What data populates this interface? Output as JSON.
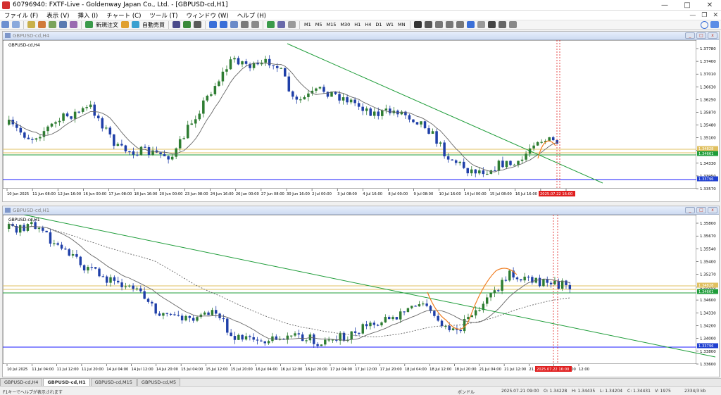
{
  "window": {
    "title": "60796940: FXTF-Live - Goldenway Japan Co., Ltd. - [GBPUSD-cd,H1]"
  },
  "menu": {
    "items": [
      "ファイル (F)",
      "表示 (V)",
      "挿入 (I)",
      "チャート (C)",
      "ツール (T)",
      "ウィンドウ (W)",
      "ヘルプ (H)"
    ]
  },
  "toolbar": {
    "new_order_label": "新規注文",
    "auto_trade_label": "自動売買",
    "timeframes": [
      "M1",
      "M5",
      "M15",
      "M30",
      "H1",
      "H4",
      "D1",
      "W1",
      "MN"
    ]
  },
  "charts": [
    {
      "window_title": "GBPUSD-cd,H4",
      "inner_label": "GBPUSD-cd,H4",
      "price_labels": [
        "1.37780",
        "1.37400",
        "1.37010",
        "1.36630",
        "1.36250",
        "1.35870",
        "1.35480",
        "1.35100",
        "1.34720",
        "1.34330",
        "1.33950",
        "1.33570"
      ],
      "time_labels": [
        "10 Jun 2025",
        "11 Jun 08:00",
        "12 Jun 16:00",
        "16 Jun 00:00",
        "17 Jun 08:00",
        "18 Jun 16:00",
        "20 Jun 00:00",
        "23 Jun 08:00",
        "24 Jun 16:00",
        "26 Jun 00:00",
        "27 Jun 08:00",
        "30 Jun 16:00",
        "2 Jul 00:00",
        "3 Jul 08:00",
        "4 Jul 16:00",
        "8 Jul 00:00",
        "9 Jul 08:00",
        "10 Jul 16:00",
        "14 Jul 00:00",
        "15 Jul 08:00",
        "16 Jul 16:00",
        "18 Jul 00:00",
        "21"
      ],
      "date_marker": "2025.07.22 16:00",
      "hline_labels": [
        "1.34828",
        "1.34661",
        "1.33796"
      ]
    },
    {
      "window_title": "GBPUSD-cd,H1",
      "inner_label": "GBPUSD-cd,H1",
      "price_labels": [
        "1.35800",
        "1.35670",
        "1.35540",
        "1.35400",
        "1.35270",
        "1.35000",
        "1.34600",
        "1.34330",
        "1.34200",
        "1.34000",
        "1.33800",
        "1.33600"
      ],
      "time_labels": [
        "10 Jul 2025",
        "11 Jul 04:00",
        "11 Jul 12:00",
        "11 Jul 20:00",
        "14 Jul 04:00",
        "14 Jul 12:00",
        "14 Jul 20:00",
        "15 Jul 04:00",
        "15 Jul 12:00",
        "15 Jul 20:00",
        "16 Jul 04:00",
        "16 Jul 12:00",
        "16 Jul 20:00",
        "17 Jul 04:00",
        "17 Jul 12:00",
        "17 Jul 20:00",
        "18 Jul 04:00",
        "18 Jul 12:00",
        "18 Jul 20:00",
        "21 Jul 04:00",
        "21 Jul 12:00",
        "21 Jul 20:00",
        "22 Jul 04:00",
        "12:00"
      ],
      "date_marker": "2025.07.22 16:00",
      "hline_labels": [
        "1.34828",
        "1.34661",
        "1.33796"
      ]
    }
  ],
  "tabs": [
    "GBPUSD-cd,H4",
    "GBPUSD-cd,H1",
    "GBPUSD-cd,M15",
    "GBPUSD-cd,M5"
  ],
  "status": {
    "help": "F1キーでヘルプが表示されます",
    "profile": "ボンドル",
    "datetime": "2025.07.21 09:00",
    "open": "O: 1.34228",
    "high": "H: 1.34435",
    "low": "L: 1.34204",
    "close": "C: 1.34431",
    "volume": "V: 1975",
    "memory": "2334/3 kb"
  },
  "colors": {
    "bull": "#2e7d32",
    "bear": "#1f3fa8",
    "trend": "#1f9d3a",
    "support": "#1a1aff",
    "resistance": "#e0c060",
    "accent_orange": "#f07c1f",
    "marker": "#e02020"
  }
}
